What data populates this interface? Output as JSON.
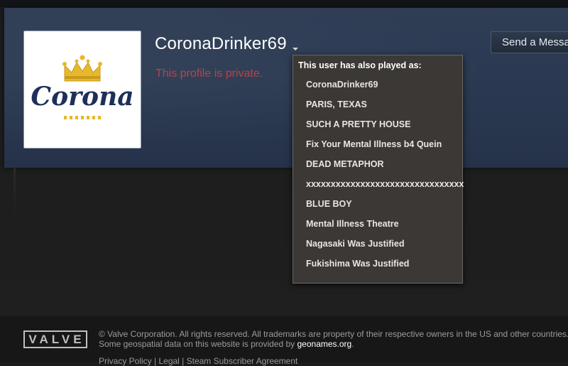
{
  "profile": {
    "persona_name": "CoronaDrinker69",
    "private_message": "This profile is private.",
    "avatar_logo_text": "Corona"
  },
  "actions": {
    "send_message_label": "Send a Message"
  },
  "aliases": {
    "title": "This user has also played as:",
    "items": [
      "CoronaDrinker69",
      "PARIS, TEXAS",
      "SUCH A PRETTY HOUSE",
      "Fix Your Mental Illness b4 Quein",
      "DEAD METAPHOR",
      "xxxxxxxxxxxxxxxxxxxxxxxxxxxxxxxx",
      "BLUE BOY",
      "Mental Illness Theatre",
      "Nagasaki Was Justified",
      "Fukishima Was Justified"
    ]
  },
  "footer": {
    "logo": "VALVE",
    "copyright": "© Valve Corporation. All rights reserved. All trademarks are property of their respective owners in the US and other countries.",
    "geo_prefix": "Some geospatial data on this website is provided by ",
    "geo_link": "geonames.org",
    "geo_suffix": ".",
    "links": "Privacy Policy | Legal | Steam Subscriber Agreement"
  },
  "colors": {
    "header_bg": "#2b3a52",
    "private_text": "#b5454a",
    "popup_bg": "#3b3835",
    "page_bg": "#1f1f1f",
    "footer_bg": "#171717"
  },
  "icons": {
    "dropdown": "chevron-down-icon",
    "crown": "crown-icon"
  }
}
